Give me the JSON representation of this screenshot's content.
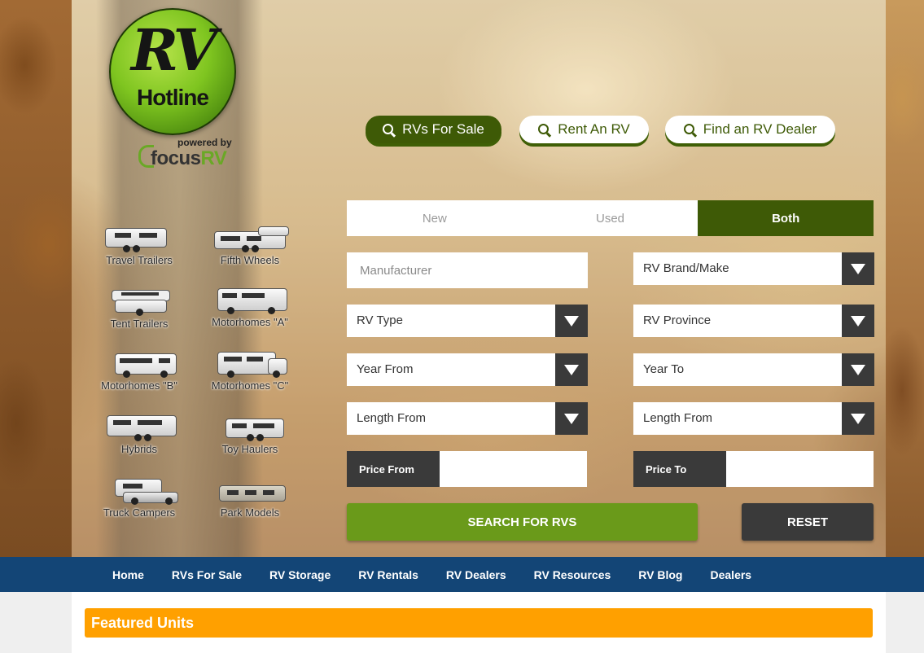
{
  "brand": {
    "logo_top": "RV",
    "logo_bottom": "Hotline",
    "powered_by": "powered by",
    "focus_text": "focus",
    "focus_rv": "RV"
  },
  "categories": [
    {
      "label": "Travel Trailers"
    },
    {
      "label": "Fifth Wheels"
    },
    {
      "label": "Tent Trailers"
    },
    {
      "label": "Motorhomes \"A\""
    },
    {
      "label": "Motorhomes \"B\""
    },
    {
      "label": "Motorhomes \"C\""
    },
    {
      "label": "Hybrids"
    },
    {
      "label": "Toy Haulers"
    },
    {
      "label": "Truck Campers"
    },
    {
      "label": "Park Models"
    }
  ],
  "search_tabs": [
    {
      "label": "RVs For Sale",
      "active": true
    },
    {
      "label": "Rent An RV",
      "active": false
    },
    {
      "label": "Find an RV Dealer",
      "active": false
    }
  ],
  "condition": {
    "options": [
      "New",
      "Used",
      "Both"
    ],
    "selected": "Both"
  },
  "form": {
    "manufacturer_placeholder": "Manufacturer",
    "brand_select": "RV Brand/Make",
    "type_select": "RV Type",
    "province_select": "RV Province",
    "year_from": "Year From",
    "year_to": "Year To",
    "length_from_left": "Length From",
    "length_from_right": "Length From",
    "price_from_label": "Price From",
    "price_to_label": "Price To",
    "search_button": "SEARCH FOR RVS",
    "reset_button": "RESET"
  },
  "nav": {
    "items": [
      "Home",
      "RVs For Sale",
      "RV Storage",
      "RV Rentals",
      "RV Dealers",
      "RV Resources",
      "RV Blog",
      "Dealers"
    ]
  },
  "featured": {
    "title": "Featured Units"
  },
  "colors": {
    "dark_green": "#3e5a06",
    "search_green": "#6a9a1a",
    "nav_blue": "#134576",
    "featured_orange": "#ffa000",
    "dark_gray": "#3a3a3a"
  }
}
